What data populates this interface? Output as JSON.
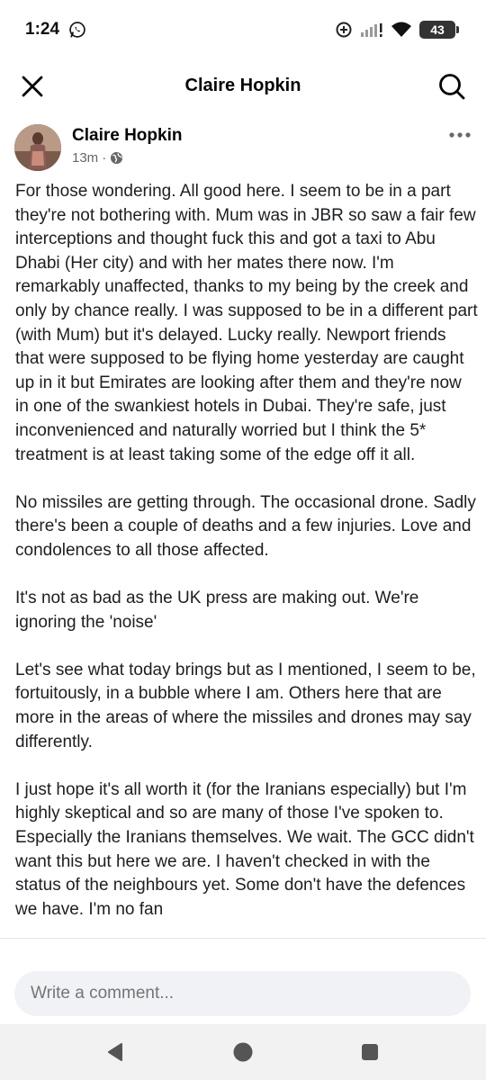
{
  "status_bar": {
    "time": "1:24",
    "battery": "43",
    "icons": [
      "whatsapp-icon",
      "data-saver-icon",
      "signal-icon",
      "wifi-icon",
      "battery-icon"
    ]
  },
  "header": {
    "title": "Claire Hopkin",
    "close_icon": "close-icon",
    "search_icon": "search-icon"
  },
  "post": {
    "author": "Claire Hopkin",
    "time": "13m",
    "separator": "·",
    "audience_icon": "globe-icon",
    "paragraphs": [
      "For those wondering. All good here. I seem to be in a part they're not bothering with. Mum was in JBR so saw a fair few interceptions and thought fuck this and got a taxi to Abu Dhabi  (Her city) and with her mates there now. I'm remarkably unaffected, thanks to my being by the creek and only by chance really. I was supposed to be in a different part (with Mum) but it's delayed. Lucky really. Newport friends that were supposed to be flying home yesterday are caught up in it but Emirates are looking after them and they're now in one of the swankiest hotels in Dubai. They're safe, just inconvenienced and naturally worried but I think the 5* treatment is at least taking some of the edge off it all.",
      "No missiles are getting through. The occasional drone. Sadly there's been a couple of deaths and a few injuries. Love and condolences to all those affected.",
      "It's not as bad as the UK press are making out. We're ignoring the 'noise'",
      "Let's see what today brings but as I mentioned, I seem to be, fortuitously, in a bubble where I am. Others here that are more in the areas of where the missiles and drones may say differently.",
      "I just hope it's all worth it (for the Iranians especially) but I'm highly skeptical and so are many of those I've spoken to. Especially the Iranians themselves. We wait. The GCC didn't want this but here we are. I haven't checked in with the status of the neighbours yet. Some don't have the defences we have. I'm no fan"
    ]
  },
  "comment": {
    "placeholder": "Write a comment..."
  },
  "navbar": {
    "back_icon": "back-triangle-icon",
    "home_icon": "home-circle-icon",
    "recents_icon": "recents-square-icon"
  },
  "colors": {
    "text": "#1c1e21",
    "secondary": "#65676b",
    "input_bg": "#f0f2f5",
    "nav_bg": "#f2f2f2"
  }
}
